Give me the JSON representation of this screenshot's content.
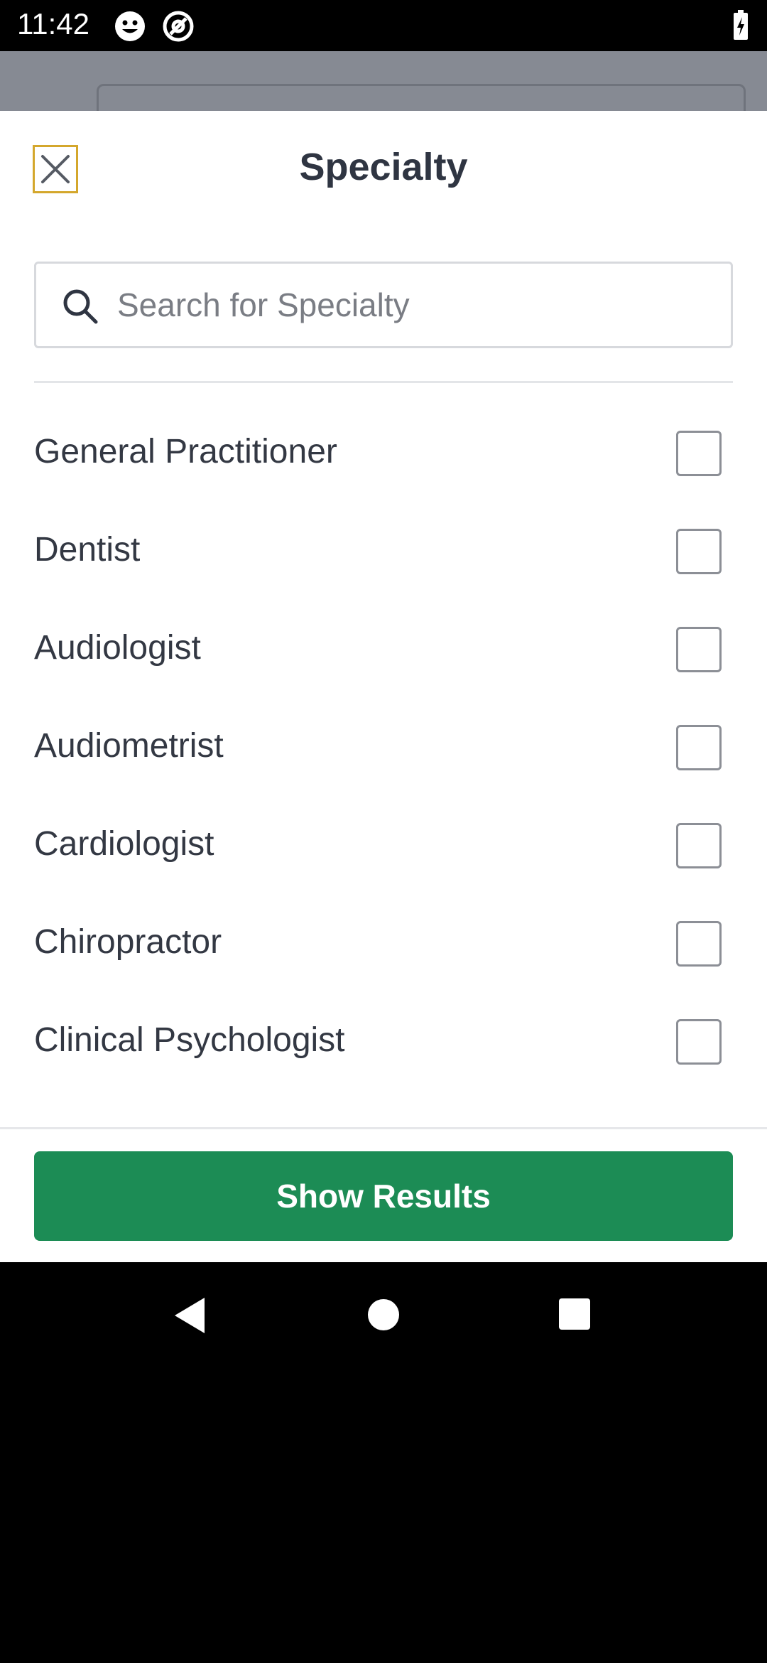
{
  "status_bar": {
    "time": "11:42",
    "icons": [
      "face-icon",
      "at-sign-icon",
      "battery-charging-icon"
    ]
  },
  "sheet": {
    "title": "Specialty",
    "close_icon": "close-icon",
    "search": {
      "placeholder": "Search for Specialty",
      "value": "",
      "icon": "search-icon"
    },
    "items": [
      {
        "label": "General Practitioner",
        "checked": false
      },
      {
        "label": "Dentist",
        "checked": false
      },
      {
        "label": "Audiologist",
        "checked": false
      },
      {
        "label": "Audiometrist",
        "checked": false
      },
      {
        "label": "Cardiologist",
        "checked": false
      },
      {
        "label": "Chiropractor",
        "checked": false
      },
      {
        "label": "Clinical Psychologist",
        "checked": false
      }
    ],
    "show_results_label": "Show Results"
  },
  "colors": {
    "accent_green": "#1c8c55",
    "close_focus_outline": "#d4a72c",
    "title_text": "#2f3542"
  },
  "nav_bar": {
    "icons": [
      "back-icon",
      "home-icon",
      "recents-icon"
    ]
  }
}
